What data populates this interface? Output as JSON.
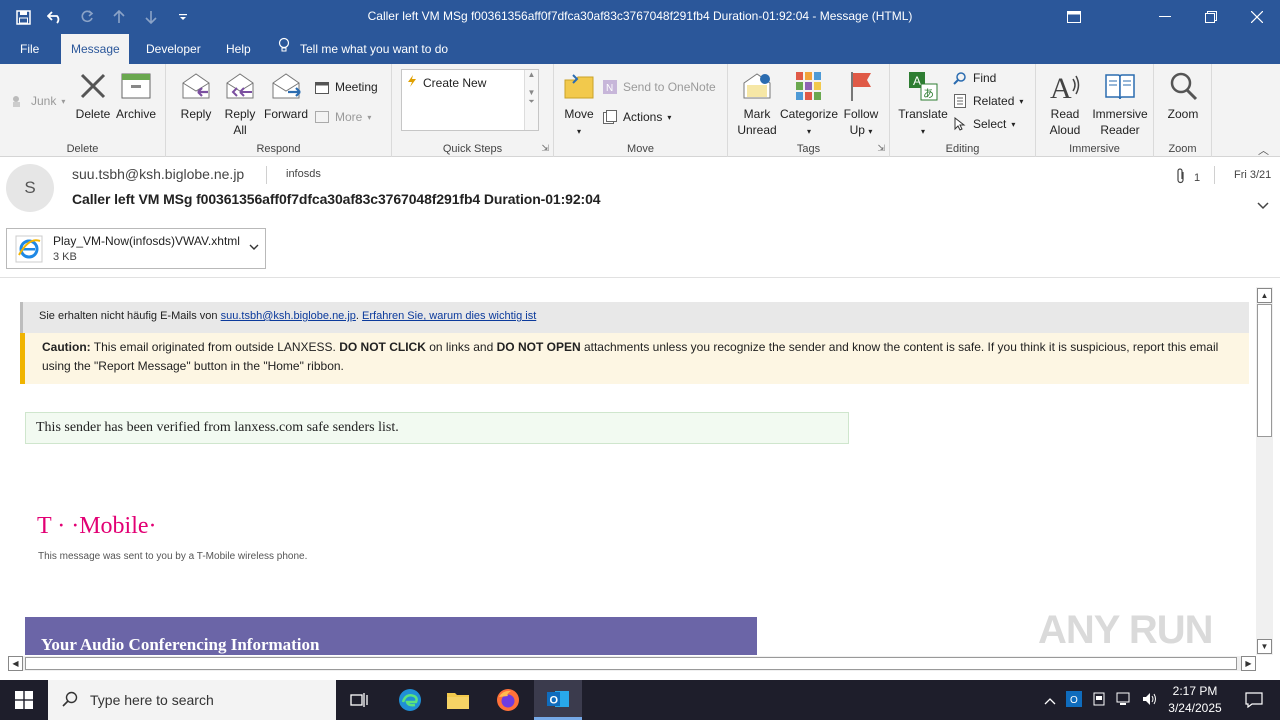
{
  "window": {
    "title": "Caller left VM MSg f00361356aff0f7dfca30af83c3767048f291fb4 Duration-01:92:04  -  Message (HTML)"
  },
  "menu": {
    "tabs": [
      "File",
      "Message",
      "Developer",
      "Help"
    ],
    "tell_me": "Tell me what you want to do"
  },
  "ribbon": {
    "junk": "Junk",
    "delete_group": {
      "label": "Delete",
      "delete": "Delete",
      "archive": "Archive"
    },
    "respond_group": {
      "label": "Respond",
      "reply": "Reply",
      "reply_all_1": "Reply",
      "reply_all_2": "All",
      "forward": "Forward",
      "meeting": "Meeting",
      "more": "More"
    },
    "quicksteps_group": {
      "label": "Quick Steps",
      "create_new": "Create New"
    },
    "move_group": {
      "label": "Move",
      "move": "Move",
      "onenote": "Send to OneNote",
      "actions": "Actions"
    },
    "tags_group": {
      "label": "Tags",
      "mark_1": "Mark",
      "mark_2": "Unread",
      "categorize": "Categorize",
      "follow_1": "Follow",
      "follow_2": "Up"
    },
    "editing_group": {
      "label": "Editing",
      "translate": "Translate",
      "find": "Find",
      "related": "Related",
      "select": "Select"
    },
    "immersive_group": {
      "label": "Immersive",
      "read_1": "Read",
      "read_2": "Aloud",
      "reader_1": "Immersive",
      "reader_2": "Reader"
    },
    "zoom_group": {
      "label": "Zoom",
      "zoom": "Zoom"
    }
  },
  "header": {
    "avatar_letter": "S",
    "sender": "suu.tsbh@ksh.biglobe.ne.jp",
    "to": "infosds",
    "subject": "Caller left VM MSg f00361356aff0f7dfca30af83c3767048f291fb4 Duration-01:92:04",
    "attachment_count": "1",
    "date": "Fri 3/21"
  },
  "attachment": {
    "name": "Play_VM-Now(infosds)VWAV.xhtml",
    "size": "3 KB"
  },
  "body": {
    "notice_prefix": "Sie erhalten nicht häufig E-Mails von ",
    "notice_email": "suu.tsbh@ksh.biglobe.ne.jp",
    "notice_sep": ". ",
    "notice_link": "Erfahren Sie, warum dies wichtig ist",
    "caution_label": "Caution:",
    "caution_1": " This email originated from outside LANXESS. ",
    "caution_bold1": "DO NOT CLICK",
    "caution_2": " on links and ",
    "caution_bold2": "DO NOT OPEN",
    "caution_3": " attachments unless you recognize the sender and know the content is safe. If you think it is suspicious, report this email using the \"Report Message\" button in the \"Home\" ribbon.",
    "verified": "This sender has been verified from lanxess.com safe senders list.",
    "brand": "T · ·Mobile·",
    "brand_sub": "This message was sent to you by a T-Mobile wireless phone.",
    "conf_title": "Your Audio Conferencing Information"
  },
  "taskbar": {
    "search_placeholder": "Type here to search",
    "time": "2:17 PM",
    "date": "3/24/2025"
  },
  "watermark": "ANY RUN",
  "colors": {
    "accent": "#2b579a",
    "caution_border": "#f0b400",
    "brand": "#e20074",
    "conf_bg": "#6b65a7"
  }
}
